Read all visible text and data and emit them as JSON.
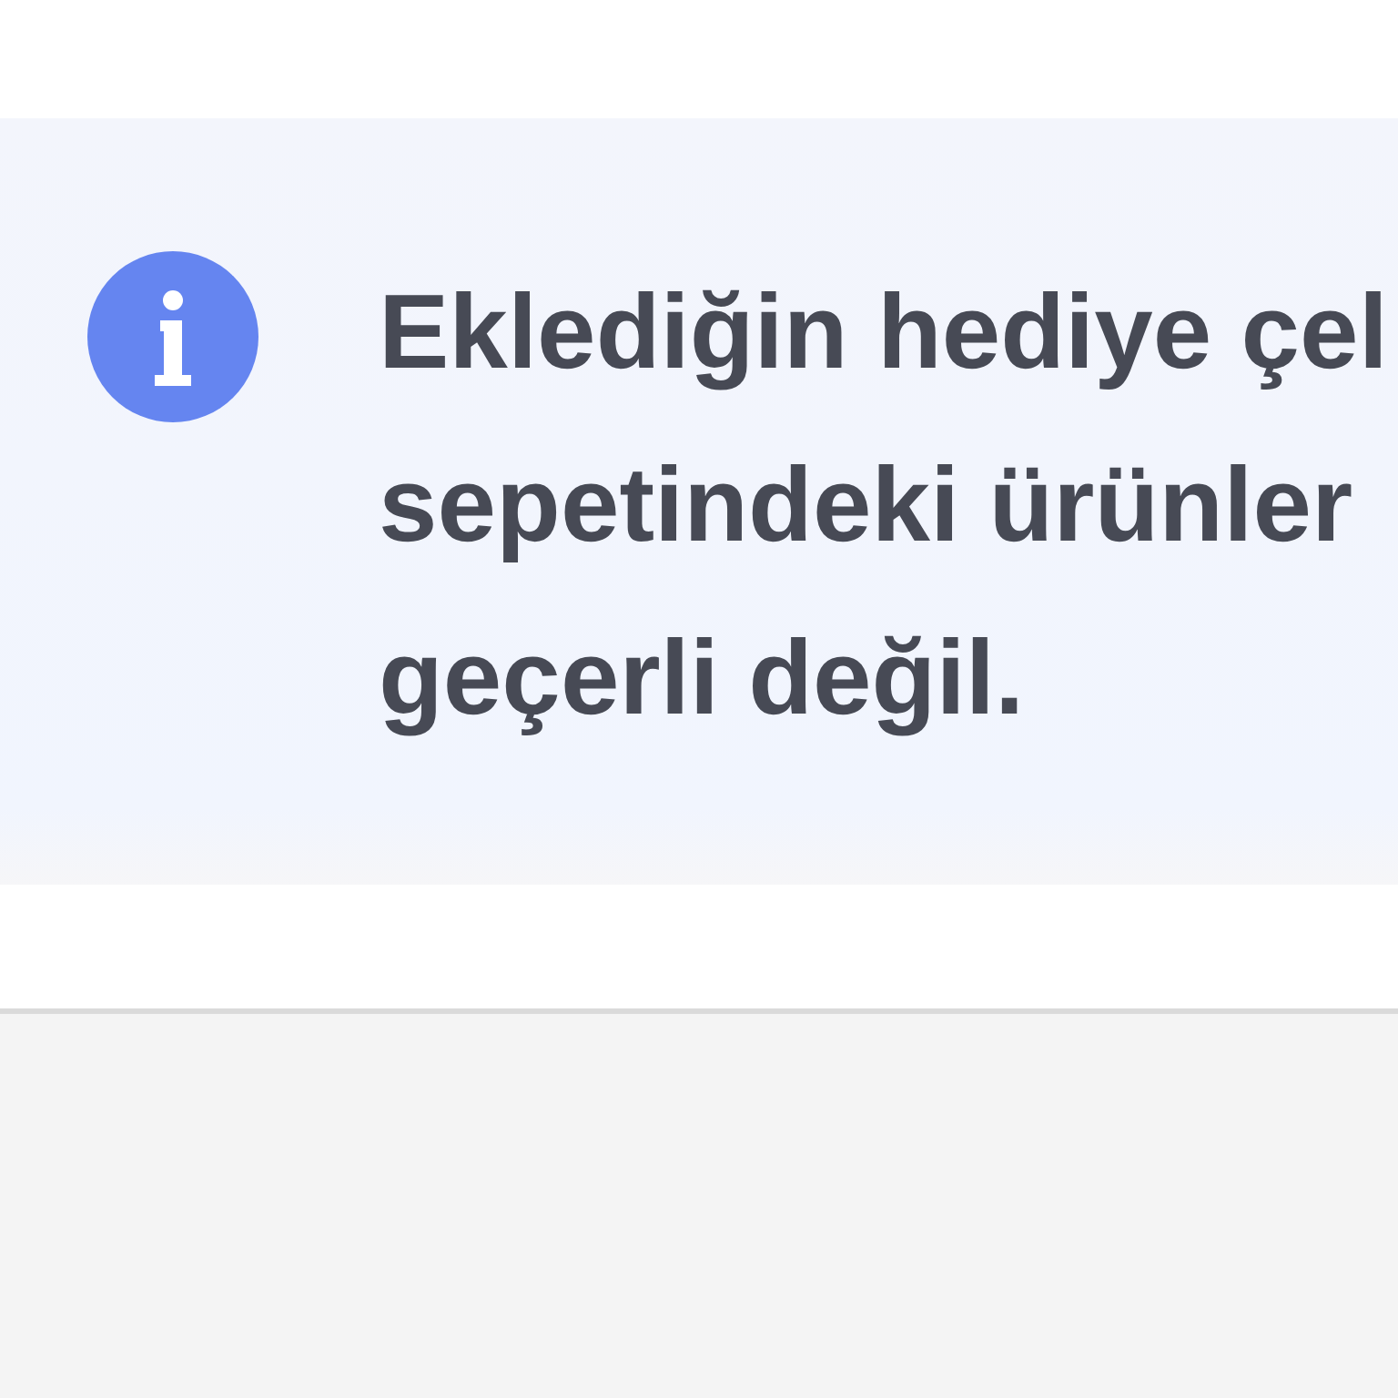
{
  "alert": {
    "kind": "info",
    "lines": [
      "Eklediğin hediye çel",
      "sepetindeki ürünler",
      "geçerli değil."
    ]
  }
}
